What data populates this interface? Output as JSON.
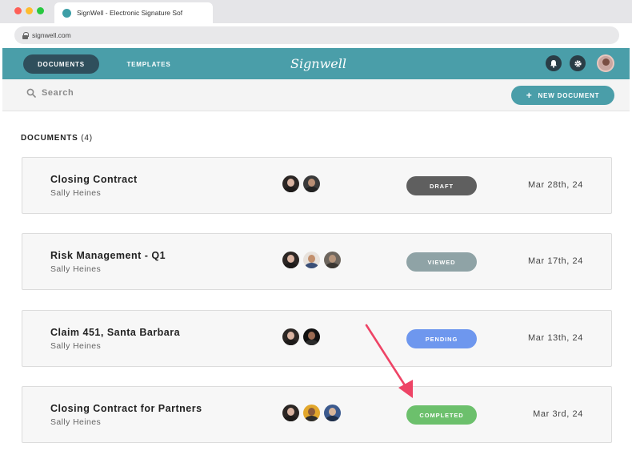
{
  "browser": {
    "tab_title": "SignWell - Electronic Signature Sof",
    "url": "signwell.com"
  },
  "header": {
    "nav_documents": "DOCUMENTS",
    "nav_templates": "TEMPLATES",
    "brand": "Signwell",
    "icons": [
      "bell-icon",
      "gear-icon",
      "user-avatar"
    ]
  },
  "toolbar": {
    "search_placeholder": "Search",
    "new_document_label": "NEW DOCUMENT",
    "new_document_icon": "+"
  },
  "section": {
    "title": "DOCUMENTS",
    "count": "(4)"
  },
  "documents": [
    {
      "name": "Closing Contract",
      "owner": "Sally Heines",
      "status": "DRAFT",
      "status_color": "#5f5f5f",
      "date": "Mar 28th, 24",
      "signer_count": 2
    },
    {
      "name": "Risk Management - Q1",
      "owner": "Sally Heines",
      "status": "VIEWED",
      "status_color": "#8fa3a6",
      "date": "Mar 17th, 24",
      "signer_count": 3
    },
    {
      "name": "Claim 451, Santa Barbara",
      "owner": "Sally Heines",
      "status": "PENDING",
      "status_color": "#6e97ee",
      "date": "Mar 13th, 24",
      "signer_count": 2
    },
    {
      "name": "Closing Contract for Partners",
      "owner": "Sally Heines",
      "status": "COMPLETED",
      "status_color": "#6cc06c",
      "date": "Mar 3rd, 24",
      "signer_count": 3
    }
  ],
  "colors": {
    "brand_teal": "#4a9ea9",
    "nav_active": "#2f4f5c",
    "annotation_arrow": "#ee4466"
  }
}
